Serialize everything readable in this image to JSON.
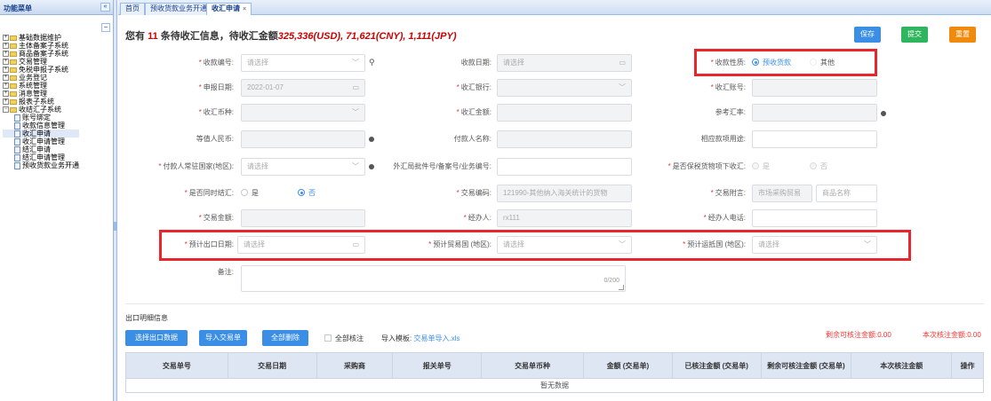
{
  "sidebar": {
    "title": "功能菜单",
    "collapse_label": "«",
    "minus_label": "−",
    "items": [
      {
        "label": "基础数据维护",
        "level": 0
      },
      {
        "label": "主体备案子系统",
        "level": 0
      },
      {
        "label": "商品备案子系统",
        "level": 0
      },
      {
        "label": "交易管理",
        "level": 0
      },
      {
        "label": "免税申报子系统",
        "level": 0
      },
      {
        "label": "业务登记",
        "level": 0
      },
      {
        "label": "系统管理",
        "level": 0
      },
      {
        "label": "消息管理",
        "level": 0
      },
      {
        "label": "报表子系统",
        "level": 0
      },
      {
        "label": "收结汇子系统",
        "level": 0
      },
      {
        "label": "账号绑定",
        "level": 1
      },
      {
        "label": "收款信息管理",
        "level": 1
      },
      {
        "label": "收汇申请",
        "level": 1,
        "active": true
      },
      {
        "label": "收汇申请管理",
        "level": 1
      },
      {
        "label": "结汇申请",
        "level": 1
      },
      {
        "label": "结汇申请管理",
        "level": 1
      },
      {
        "label": "预收货款业务开通",
        "level": 1
      }
    ]
  },
  "tabs": [
    {
      "label": "首页"
    },
    {
      "label": "预收货款业务开通",
      "close": "×"
    },
    {
      "label": "收汇申请",
      "close": "×",
      "active": true
    }
  ],
  "headline": {
    "prefix": "您有",
    "count": "11",
    "middle": "条待收汇信息，待收汇金额",
    "amounts": "325,336(USD), 71,621(CNY), 1,111(JPY)"
  },
  "actions": {
    "save": "保存",
    "submit": "提交",
    "reset": "重置"
  },
  "form": {
    "receipt_no": {
      "label": "收款编号:",
      "placeholder": "请选择"
    },
    "receipt_date": {
      "label": "收款日期:",
      "placeholder": "请选择"
    },
    "receipt_nature": {
      "label": "收款性质:",
      "options": [
        "预收货款",
        "其他"
      ]
    },
    "declare_date": {
      "label": "申报日期:",
      "value": "2022-01-07"
    },
    "receiving_bank": {
      "label": "收汇银行:"
    },
    "receiving_account": {
      "label": "收汇账号:"
    },
    "currency": {
      "label": "收汇币种:"
    },
    "amount": {
      "label": "收汇金额:"
    },
    "ref_rate": {
      "label": "参考汇率:"
    },
    "rmb_equiv": {
      "label": "等值人民币:"
    },
    "payer_name": {
      "label": "付款人名称:"
    },
    "purpose": {
      "label": "相应款项用途:"
    },
    "payer_country": {
      "label": "付款人常驻国家(地区):",
      "placeholder": "请选择"
    },
    "approval_no": {
      "label": "外汇局批件号/备案号/业务编号:"
    },
    "bonded": {
      "label": "是否保税货物项下收汇:",
      "options": [
        "是",
        "否"
      ]
    },
    "same_time_settle": {
      "label": "是否同时结汇:",
      "options": [
        "是",
        "否"
      ]
    },
    "trade_code": {
      "label": "交易编码:",
      "value": "121990-其他纳入海关统计的货物"
    },
    "trade_note": {
      "label": "交易附言:",
      "placeholders": [
        "市场采购贸易",
        "商品名称"
      ]
    },
    "trade_amount": {
      "label": "交易金额:"
    },
    "handler": {
      "label": "经办人:",
      "value": "rx111"
    },
    "handler_phone": {
      "label": "经办人电话:"
    },
    "export_date": {
      "label": "预计出口日期:",
      "placeholder": "请选择"
    },
    "trade_country": {
      "label": "预计贸易国 (地区):",
      "placeholder": "请选择"
    },
    "dest_country": {
      "label": "预计运抵国 (地区):",
      "placeholder": "请选择"
    },
    "remark": {
      "label": "备注:",
      "count": "0/200"
    }
  },
  "detail": {
    "title": "出口明细信息",
    "btn_select": "选择出口数据",
    "btn_import": "导入交易单",
    "btn_delete": "全部删除",
    "check_all": "全部核注",
    "template_prefix": "导入模板:",
    "template_link": "交易单导入.xls",
    "remaining": "剩余可核注金额:0.00",
    "this_time": "本次核注金额:0.00",
    "columns": [
      "交易单号",
      "交易日期",
      "采购商",
      "报关单号",
      "交易单币种",
      "金额 (交易单)",
      "已核注金额 (交易单)",
      "剩余可核注金额 (交易单)",
      "本次核注金额",
      "操作"
    ],
    "empty": "暂无数据"
  }
}
